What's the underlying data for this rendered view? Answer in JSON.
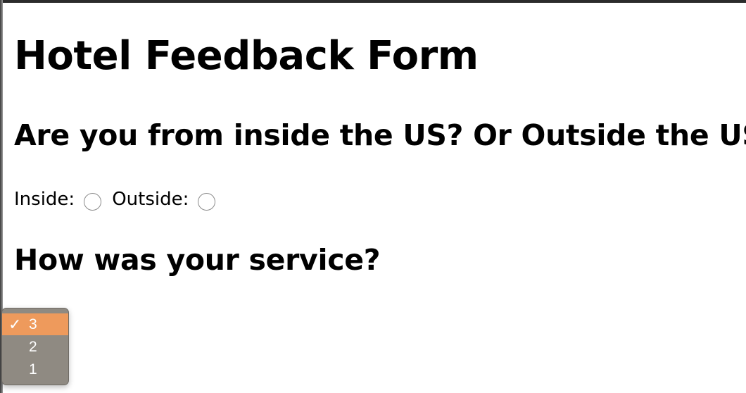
{
  "page": {
    "title": "Hotel Feedback Form"
  },
  "location_question": {
    "heading": "Are you from inside the US? Or Outside the US?",
    "options": [
      {
        "label": "Inside:",
        "checked": false
      },
      {
        "label": "Outside:",
        "checked": false
      }
    ]
  },
  "service_question": {
    "heading": "How was your service?"
  },
  "rating_dropdown": {
    "options": [
      {
        "value": "3",
        "selected": true,
        "check_mark": "✓"
      },
      {
        "value": "2",
        "selected": false
      },
      {
        "value": "1",
        "selected": false
      }
    ],
    "highlight_color": "#ee9a5c",
    "menu_color": "#8f8a82"
  }
}
